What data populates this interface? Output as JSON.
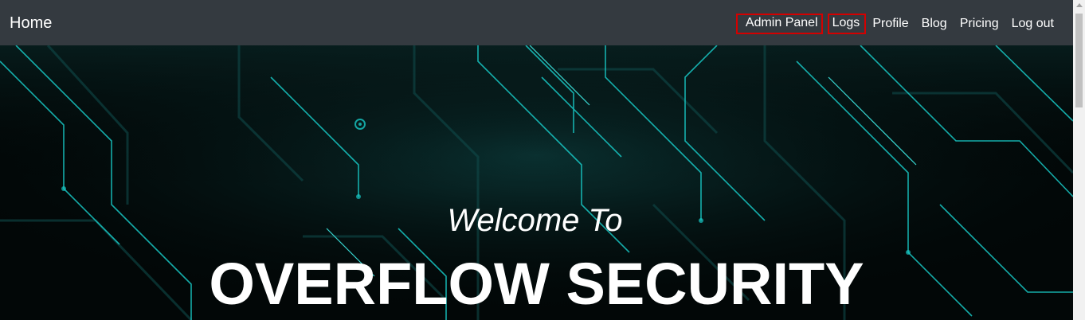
{
  "navbar": {
    "brand": "Home",
    "links": [
      {
        "label": "Admin Panel"
      },
      {
        "label": "Logs"
      },
      {
        "label": "Profile"
      },
      {
        "label": "Blog"
      },
      {
        "label": "Pricing"
      },
      {
        "label": "Log out"
      }
    ]
  },
  "hero": {
    "subtitle": "Welcome To",
    "title": "OVERFLOW SECURITY"
  },
  "colors": {
    "navbar_bg": "#343a40",
    "highlight_border": "#d40000",
    "circuit_accent": "#18c9c6"
  }
}
